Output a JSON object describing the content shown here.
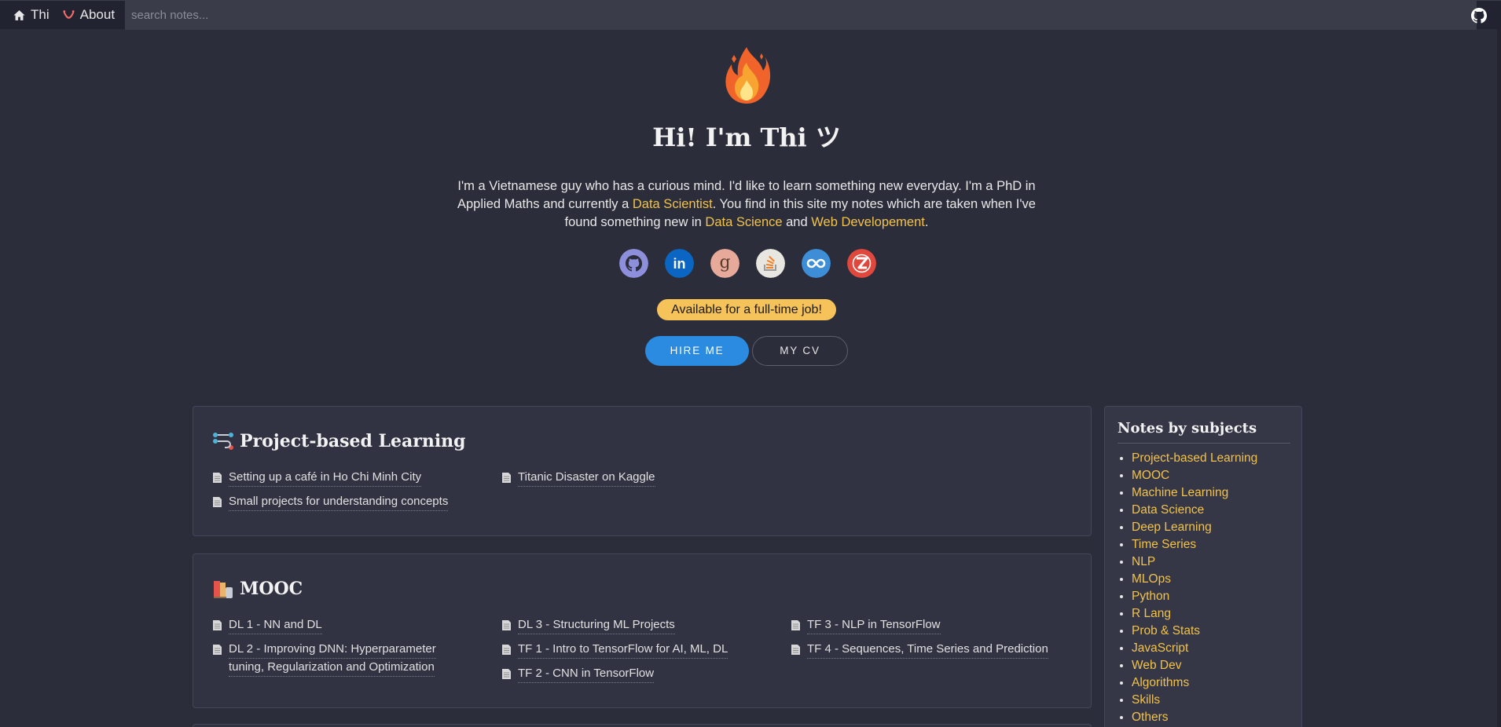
{
  "nav": {
    "home_label": "Thi",
    "about_label": "About",
    "search_placeholder": "search notes..."
  },
  "hero": {
    "title": "Hi! I'm Thi ツ",
    "desc_1": "I'm a Vietnamese guy who has a curious mind. I'd like to learn something new everyday. I'm a PhD in Applied Maths and currently a ",
    "link_data_scientist": "Data Scientist",
    "desc_2": ". You find in this site my notes which are taken when I've found something new in ",
    "link_data_science": "Data Science",
    "desc_3": " and ",
    "link_web_dev": "Web Developement",
    "desc_4": "."
  },
  "socials": [
    "github-icon",
    "linkedin-icon",
    "goodreads-icon",
    "stackoverflow-icon",
    "codersrank-icon",
    "codewars-icon"
  ],
  "badge": "Available for a full-time job!",
  "buttons": {
    "hire": "HIRE ME",
    "cv": "MY CV"
  },
  "project_card": {
    "title": "Project-based Learning",
    "notes": [
      "Setting up a café in Ho Chi Minh City",
      "Titanic Disaster on Kaggle",
      "Small projects for understanding concepts"
    ]
  },
  "mooc_card": {
    "title": "MOOC",
    "notes": [
      "DL 1 - NN and DL",
      "DL 2 - Improving DNN: Hyperparameter",
      "tuning, Regularization and Optimization",
      "DL 3 - Structuring ML Projects",
      "TF 1 - Intro to TensorFlow for AI, ML, DL",
      "TF 2 - CNN in TensorFlow",
      "TF 3 - NLP in TensorFlow",
      "TF 4 - Sequences, Time Series and Prediction"
    ]
  },
  "sidebar": {
    "title": "Notes by subjects",
    "items": [
      "Project-based Learning",
      "MOOC",
      "Machine Learning",
      "Data Science",
      "Deep Learning",
      "Time Series",
      "NLP",
      "MLOps",
      "Python",
      "R Lang",
      "Prob & Stats",
      "JavaScript",
      "Web Dev",
      "Algorithms",
      "Skills",
      "Others"
    ]
  },
  "colors": {
    "accent": "#f2c24b",
    "primary_button": "#2a8be0",
    "badge": "#f6c25a",
    "background": "#2b2d3a"
  }
}
